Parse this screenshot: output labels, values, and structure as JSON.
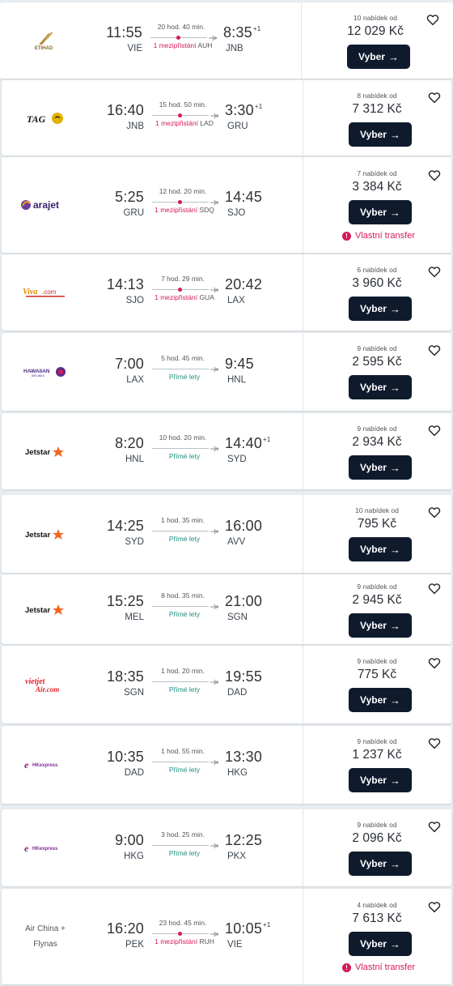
{
  "select_label": "Vyber",
  "flights": [
    {
      "airline": "Etihad",
      "logo": "etihad-logo",
      "dep_time": "11:55",
      "dep_code": "VIE",
      "arr_time": "8:35",
      "arr_plus": "+1",
      "arr_code": "JNB",
      "duration": "20 hod. 40 min.",
      "stops": "1 mezipřistání",
      "stop_airport": "AUH",
      "offers": "10 nabídek od",
      "price": "12 029 Kč",
      "warning": null
    },
    {
      "airline": "TAAG",
      "logo": "taag-logo",
      "dep_time": "16:40",
      "dep_code": "JNB",
      "arr_time": "3:30",
      "arr_plus": "+1",
      "arr_code": "GRU",
      "duration": "15 hod. 50 min.",
      "stops": "1 mezipřistání",
      "stop_airport": "LAD",
      "offers": "8 nabídek od",
      "price": "7 312 Kč",
      "warning": null
    },
    {
      "airline": "arajet",
      "logo": "arajet-logo",
      "dep_time": "5:25",
      "dep_code": "GRU",
      "arr_time": "14:45",
      "arr_plus": "",
      "arr_code": "SJO",
      "duration": "12 hod. 20 min.",
      "stops": "1 mezipřistání",
      "stop_airport": "SDQ",
      "offers": "7 nabídek od",
      "price": "3 384 Kč",
      "warning": "Vlastní transfer"
    },
    {
      "airline": "Volaris / Viva",
      "logo": "viva-logo",
      "dep_time": "14:13",
      "dep_code": "SJO",
      "arr_time": "20:42",
      "arr_plus": "",
      "arr_code": "LAX",
      "duration": "7 hod. 29 min.",
      "stops": "1 mezipřistání",
      "stop_airport": "GUA",
      "offers": "6 nabídek od",
      "price": "3 960 Kč",
      "warning": null
    },
    {
      "airline": "Hawaiian Airlines",
      "logo": "hawaiian-logo",
      "dep_time": "7:00",
      "dep_code": "LAX",
      "arr_time": "9:45",
      "arr_plus": "",
      "arr_code": "HNL",
      "duration": "5 hod. 45 min.",
      "stops": "Přímé lety",
      "stop_airport": "",
      "offers": "9 nabídek od",
      "price": "2 595 Kč",
      "warning": null
    },
    {
      "airline": "Jetstar",
      "logo": "jetstar-logo",
      "dep_time": "8:20",
      "dep_code": "HNL",
      "arr_time": "14:40",
      "arr_plus": "+1",
      "arr_code": "SYD",
      "duration": "10 hod. 20 min.",
      "stops": "Přímé lety",
      "stop_airport": "",
      "offers": "9 nabídek od",
      "price": "2 934 Kč",
      "warning": null
    },
    {
      "airline": "Jetstar",
      "logo": "jetstar-logo",
      "dep_time": "14:25",
      "dep_code": "SYD",
      "arr_time": "16:00",
      "arr_plus": "",
      "arr_code": "AVV",
      "duration": "1 hod. 35 min.",
      "stops": "Přímé lety",
      "stop_airport": "",
      "offers": "10 nabídek od",
      "price": "795 Kč",
      "warning": null
    },
    {
      "airline": "Jetstar",
      "logo": "jetstar-logo",
      "dep_time": "15:25",
      "dep_code": "MEL",
      "arr_time": "21:00",
      "arr_plus": "",
      "arr_code": "SGN",
      "duration": "8 hod. 35 min.",
      "stops": "Přímé lety",
      "stop_airport": "",
      "offers": "9 nabídek od",
      "price": "2 945 Kč",
      "warning": null
    },
    {
      "airline": "VietJet Air",
      "logo": "vietjet-logo",
      "dep_time": "18:35",
      "dep_code": "SGN",
      "arr_time": "19:55",
      "arr_plus": "",
      "arr_code": "DAD",
      "duration": "1 hod. 20 min.",
      "stops": "Přímé lety",
      "stop_airport": "",
      "offers": "9 nabídek od",
      "price": "775 Kč",
      "warning": null
    },
    {
      "airline": "HK Express",
      "logo": "hkexpress-logo",
      "dep_time": "10:35",
      "dep_code": "DAD",
      "arr_time": "13:30",
      "arr_plus": "",
      "arr_code": "HKG",
      "duration": "1 hod. 55 min.",
      "stops": "Přímé lety",
      "stop_airport": "",
      "offers": "9 nabídek od",
      "price": "1 237 Kč",
      "warning": null
    },
    {
      "airline": "HK Express",
      "logo": "hkexpress-logo",
      "dep_time": "9:00",
      "dep_code": "HKG",
      "arr_time": "12:25",
      "arr_plus": "",
      "arr_code": "PKX",
      "duration": "3 hod. 25 min.",
      "stops": "Přímé lety",
      "stop_airport": "",
      "offers": "9 nabídek od",
      "price": "2 096 Kč",
      "warning": null
    },
    {
      "airline": "Air China + Flynas",
      "logo": "text",
      "dep_time": "16:20",
      "dep_code": "PEK",
      "arr_time": "10:05",
      "arr_plus": "+1",
      "arr_code": "VIE",
      "duration": "23 hod. 45 min.",
      "stops": "1 mezipřistání",
      "stop_airport": "RUH",
      "offers": "4 nabídek od",
      "price": "7 613 Kč",
      "warning": "Vlastní transfer",
      "airline_line1": "Air China +",
      "airline_line2": "Flynas"
    }
  ]
}
